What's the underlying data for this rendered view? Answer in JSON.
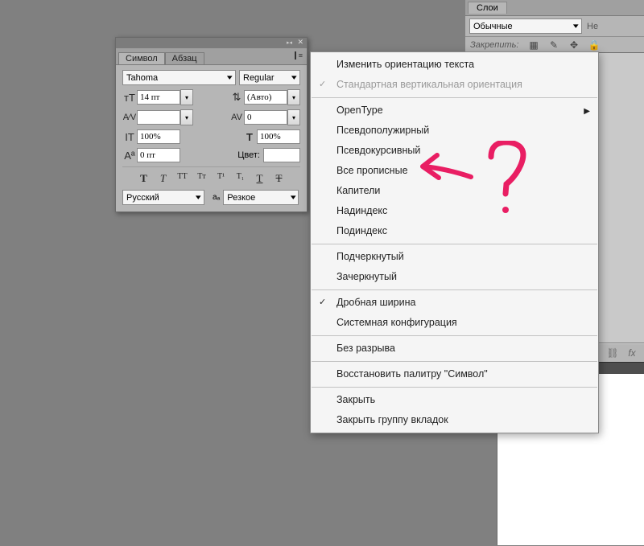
{
  "layers_panel": {
    "tab": "Слои",
    "blend_mode": "Обычные",
    "opacity_partial": "Не",
    "lock_label": "Закрепить:"
  },
  "char_panel": {
    "tabs": {
      "symbol": "Символ",
      "paragraph": "Абзац"
    },
    "font_family": "Tahoma",
    "font_style": "Regular",
    "size": "14 пт",
    "leading": "(Авто)",
    "kerning": "",
    "tracking": "0",
    "v_scale": "100%",
    "h_scale": "100%",
    "baseline": "0 пт",
    "color_label": "Цвет:",
    "language": "Русский",
    "antialias": "Резкое"
  },
  "popup_menu": {
    "g1": [
      {
        "label": "Изменить ориентацию текста",
        "disabled": false,
        "checked": false
      },
      {
        "label": "Стандартная вертикальная ориентация",
        "disabled": true,
        "checked": true
      }
    ],
    "g2": [
      {
        "label": "OpenType",
        "disabled": false,
        "submenu": true
      },
      {
        "label": "Псевдополужирный",
        "disabled": false
      },
      {
        "label": "Псевдокурсивный",
        "disabled": false
      },
      {
        "label": "Все прописные",
        "disabled": false
      },
      {
        "label": "Капители",
        "disabled": false
      },
      {
        "label": "Надиндекс",
        "disabled": false
      },
      {
        "label": "Подиндекс",
        "disabled": false
      }
    ],
    "g3": [
      {
        "label": "Подчеркнутый",
        "disabled": false
      },
      {
        "label": "Зачеркнутый",
        "disabled": false
      }
    ],
    "g4": [
      {
        "label": "Дробная ширина",
        "disabled": false,
        "checked": true
      },
      {
        "label": "Системная конфигурация",
        "disabled": false
      }
    ],
    "g5": [
      {
        "label": "Без разрыва",
        "disabled": false
      }
    ],
    "g6": [
      {
        "label": "Восстановить палитру \"Символ\"",
        "disabled": false
      }
    ],
    "g7": [
      {
        "label": "Закрыть",
        "disabled": false
      },
      {
        "label": "Закрыть группу вкладок",
        "disabled": false
      }
    ]
  }
}
